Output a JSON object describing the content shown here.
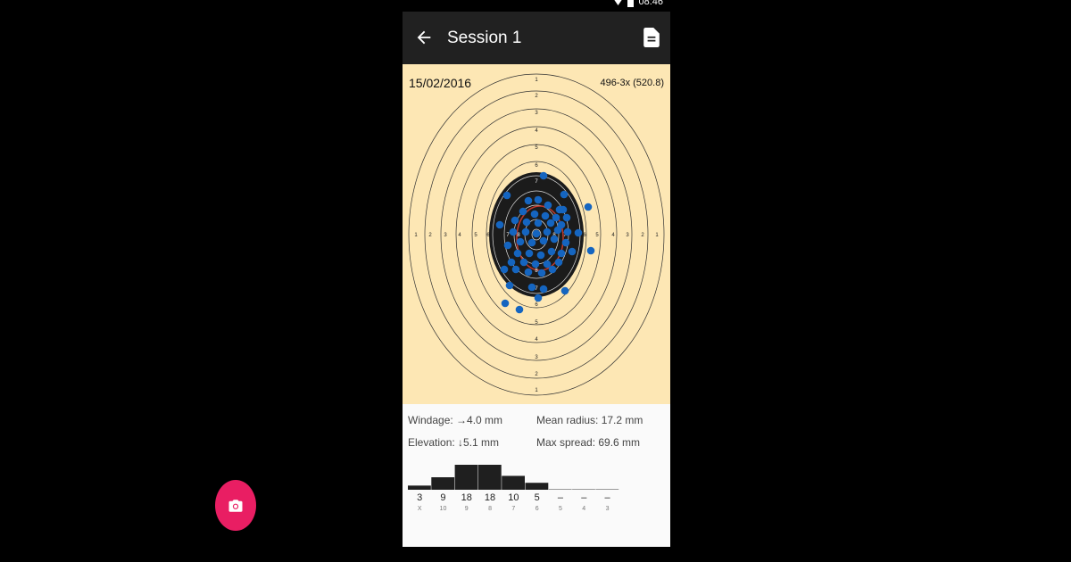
{
  "status_bar": {
    "time": "08:46"
  },
  "app_bar": {
    "title": "Session 1"
  },
  "target": {
    "date": "15/02/2016",
    "score": "496-3x (520.8)",
    "ring_labels": [
      "1",
      "2",
      "3",
      "4",
      "5",
      "6",
      "7",
      "8"
    ]
  },
  "stats": {
    "windage": "Windage: →4.0 mm",
    "elevation": "Elevation: ↓5.1 mm",
    "mean_radius": "Mean radius: 17.2 mm",
    "max_spread": "Max spread: 69.6 mm"
  },
  "chart_data": {
    "type": "bar",
    "categories": [
      "X",
      "10",
      "9",
      "8",
      "7",
      "6",
      "5",
      "4",
      "3"
    ],
    "values": [
      3,
      9,
      18,
      18,
      10,
      5,
      0,
      0,
      0
    ],
    "value_labels": [
      "3",
      "9",
      "18",
      "18",
      "10",
      "5",
      "–",
      "–",
      "–"
    ]
  },
  "colors": {
    "accent": "#e91e63",
    "app_bar": "#212121",
    "target_bg": "#fde7b4",
    "shot": "#1565c0"
  },
  "icons": {
    "back": "arrow-back-icon",
    "document": "document-icon",
    "camera": "camera-icon"
  }
}
